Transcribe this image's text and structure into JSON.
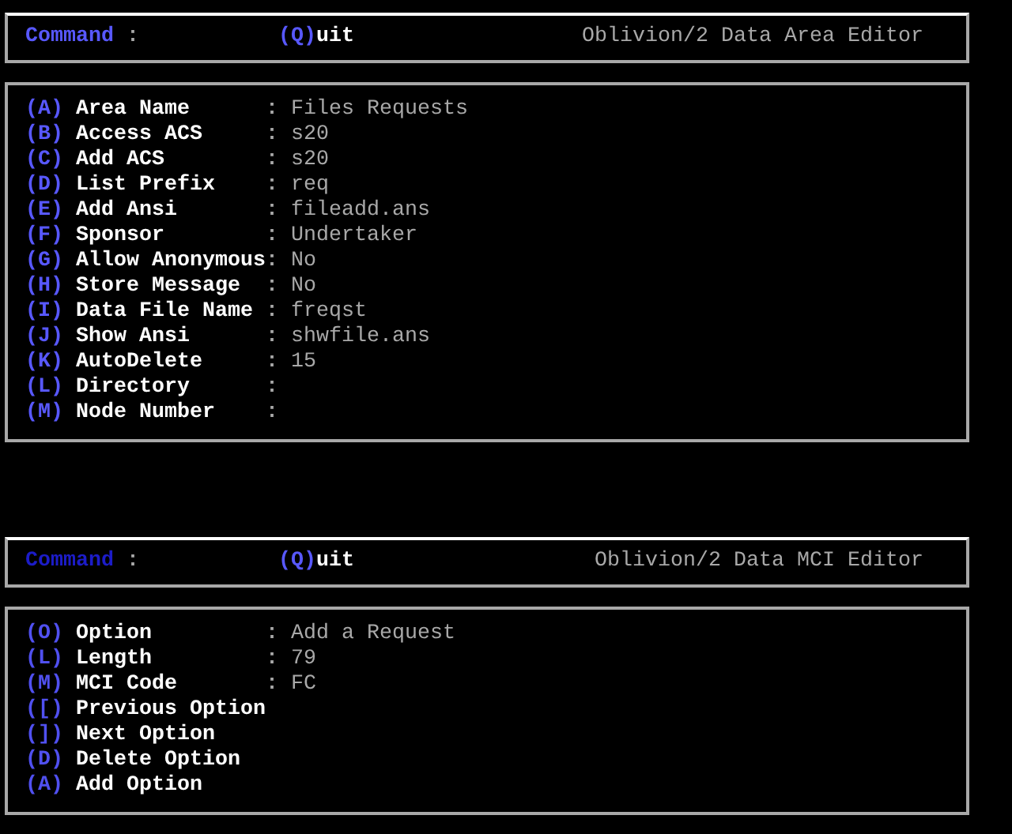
{
  "editors": [
    {
      "active": true,
      "command": "Command",
      "command_separator": ":",
      "quit": {
        "key": "(Q)",
        "rest": "uit"
      },
      "title": "Oblivion/2 Data Area Editor",
      "rows": [
        {
          "kind": "field",
          "key": "(A)",
          "label": "Area Name",
          "separator": ":",
          "value": "Files Requests"
        },
        {
          "kind": "field",
          "key": "(B)",
          "label": "Access ACS",
          "separator": ":",
          "value": "s20"
        },
        {
          "kind": "field",
          "key": "(C)",
          "label": "Add ACS",
          "separator": ":",
          "value": "s20"
        },
        {
          "kind": "field",
          "key": "(D)",
          "label": "List Prefix",
          "separator": ":",
          "value": "req"
        },
        {
          "kind": "field",
          "key": "(E)",
          "label": "Add Ansi",
          "separator": ":",
          "value": "fileadd.ans"
        },
        {
          "kind": "field",
          "key": "(F)",
          "label": "Sponsor",
          "separator": ":",
          "value": "Undertaker"
        },
        {
          "kind": "field",
          "key": "(G)",
          "label": "Allow Anonymous",
          "separator": ":",
          "value": "No"
        },
        {
          "kind": "field",
          "key": "(H)",
          "label": "Store Message",
          "separator": ":",
          "value": "No"
        },
        {
          "kind": "field",
          "key": "(I)",
          "label": "Data File Name",
          "separator": ":",
          "value": "freqst"
        },
        {
          "kind": "field",
          "key": "(J)",
          "label": "Show Ansi",
          "separator": ":",
          "value": "shwfile.ans"
        },
        {
          "kind": "field",
          "key": "(K)",
          "label": "AutoDelete",
          "separator": ":",
          "value": "15"
        },
        {
          "kind": "field",
          "key": "(L)",
          "label": "Directory",
          "separator": ":"
        },
        {
          "kind": "field",
          "key": "(M)",
          "label": "Node Number",
          "separator": ":"
        }
      ]
    },
    {
      "active": false,
      "command": "Command",
      "command_separator": ":",
      "quit": {
        "key": "(Q)",
        "rest": "uit"
      },
      "title": "Oblivion/2 Data MCI Editor",
      "rows": [
        {
          "kind": "field",
          "key": "(O)",
          "label": "Option",
          "separator": ":",
          "value": "Add a Request"
        },
        {
          "kind": "field",
          "key": "(L)",
          "label": "Length",
          "separator": ":",
          "value": "79"
        },
        {
          "kind": "field",
          "key": "(M)",
          "label": "MCI Code",
          "separator": ":",
          "value": "FC"
        },
        {
          "kind": "action",
          "key": "([)",
          "label": "Previous Option"
        },
        {
          "kind": "action",
          "key": "(])",
          "label": "Next Option"
        },
        {
          "kind": "action",
          "key": "(D)",
          "label": "Delete Option"
        },
        {
          "kind": "action",
          "key": "(A)",
          "label": "Add Option"
        }
      ]
    }
  ]
}
